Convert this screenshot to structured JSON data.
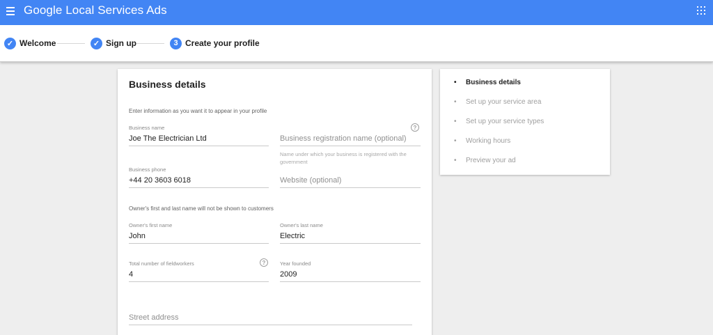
{
  "appbar": {
    "title": "Google Local Services Ads",
    "menu_icon": "hamburger-menu-icon",
    "apps_icon": "apps-grid-icon",
    "color": "#4285f4"
  },
  "stepper": {
    "steps": [
      {
        "label": "Welcome",
        "state": "done",
        "marker": "✓"
      },
      {
        "label": "Sign up",
        "state": "done",
        "marker": "✓"
      },
      {
        "label": "Create your profile",
        "state": "current",
        "marker": "3"
      }
    ]
  },
  "form": {
    "title": "Business details",
    "intro": "Enter information as you want it to appear in your profile",
    "business_name": {
      "label": "Business name",
      "value": "Joe The Electrician Ltd"
    },
    "registration_name": {
      "placeholder": "Business registration name (optional)",
      "hint": "Name under which your business is registered with the government"
    },
    "business_phone": {
      "label": "Business phone",
      "value": "+44 20 3603 6018"
    },
    "website": {
      "placeholder": "Website (optional)"
    },
    "owner_note": "Owner's first and last name will not be shown to customers",
    "owner_first": {
      "label": "Owner's first name",
      "value": "John"
    },
    "owner_last": {
      "label": "Owner's last name",
      "value": "Electric"
    },
    "fieldworkers": {
      "label": "Total number of fieldworkers",
      "value": "4"
    },
    "year_founded": {
      "label": "Year founded",
      "value": "2009"
    },
    "street_address": {
      "placeholder": "Street address"
    },
    "help_glyph": "?"
  },
  "sidenav": {
    "items": [
      {
        "label": "Business details",
        "active": true
      },
      {
        "label": "Set up your service area",
        "active": false
      },
      {
        "label": "Set up your service types",
        "active": false
      },
      {
        "label": "Working hours",
        "active": false
      },
      {
        "label": "Preview your ad",
        "active": false
      }
    ],
    "bullet": "•"
  }
}
